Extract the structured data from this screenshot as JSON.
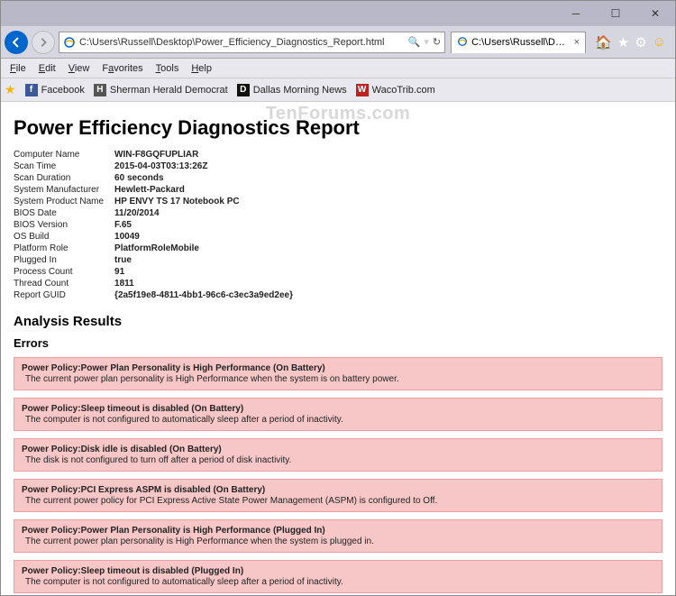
{
  "window": {
    "minimize": "─",
    "maximize": "☐",
    "close": "✕"
  },
  "nav": {
    "address": "C:\\Users\\Russell\\Desktop\\Power_Efficiency_Diagnostics_Report.html",
    "search_sym": "🔍",
    "refresh_sym": "↻"
  },
  "tab": {
    "title": "C:\\Users\\Russell\\Desktop\\P..."
  },
  "menu": {
    "file": "File",
    "edit": "Edit",
    "view": "View",
    "favorites": "Favorites",
    "tools": "Tools",
    "help": "Help"
  },
  "favs": {
    "facebook": "Facebook",
    "sherman": "Sherman Herald Democrat",
    "dallas": "Dallas Morning News",
    "waco": "WacoTrib.com"
  },
  "watermark": "TenForums.com",
  "report": {
    "title": "Power Efficiency Diagnostics Report",
    "meta": [
      {
        "k": "Computer Name",
        "v": "WIN-F8GQFUPLIAR"
      },
      {
        "k": "Scan Time",
        "v": "2015-04-03T03:13:26Z"
      },
      {
        "k": "Scan Duration",
        "v": "60 seconds"
      },
      {
        "k": "System Manufacturer",
        "v": "Hewlett-Packard"
      },
      {
        "k": "System Product Name",
        "v": "HP ENVY TS 17 Notebook PC"
      },
      {
        "k": "BIOS Date",
        "v": "11/20/2014"
      },
      {
        "k": "BIOS Version",
        "v": "F.65"
      },
      {
        "k": "OS Build",
        "v": "10049"
      },
      {
        "k": "Platform Role",
        "v": "PlatformRoleMobile"
      },
      {
        "k": "Plugged In",
        "v": "true"
      },
      {
        "k": "Process Count",
        "v": "91"
      },
      {
        "k": "Thread Count",
        "v": "1811"
      },
      {
        "k": "Report GUID",
        "v": "{2a5f19e8-4811-4bb1-96c6-c3ec3a9ed2ee}"
      }
    ],
    "analysis_heading": "Analysis Results",
    "errors_heading": "Errors",
    "errors": [
      {
        "title": "Power Policy:Power Plan Personality is High Performance (On Battery)",
        "desc": "The current power plan personality is High Performance when the system is on battery power."
      },
      {
        "title": "Power Policy:Sleep timeout is disabled (On Battery)",
        "desc": "The computer is not configured to automatically sleep after a period of inactivity."
      },
      {
        "title": "Power Policy:Disk idle is disabled (On Battery)",
        "desc": "The disk is not configured to turn off after a period of disk inactivity."
      },
      {
        "title": "Power Policy:PCI Express ASPM is disabled (On Battery)",
        "desc": "The current power policy for PCI Express Active State Power Management (ASPM) is configured to Off."
      },
      {
        "title": "Power Policy:Power Plan Personality is High Performance (Plugged In)",
        "desc": "The current power plan personality is High Performance when the system is plugged in."
      },
      {
        "title": "Power Policy:Sleep timeout is disabled (Plugged In)",
        "desc": "The computer is not configured to automatically sleep after a period of inactivity."
      }
    ]
  }
}
